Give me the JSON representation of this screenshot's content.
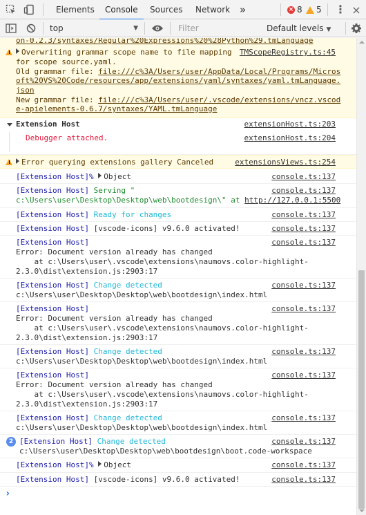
{
  "toolbar": {
    "tabs": [
      "Elements",
      "Console",
      "Sources",
      "Network"
    ],
    "more": "»",
    "errors": "8",
    "warnings": "5",
    "menu": "⋮"
  },
  "filterbar": {
    "context": "top",
    "filter_placeholder": "Filter",
    "levels": "Default levels"
  },
  "colors": {
    "accent": "#1a73e8",
    "warn_bg": "#fffbe5",
    "blue_text": "#1a1aa6",
    "cyan_text": "#22b7d8",
    "error_red": "#e0183c"
  },
  "messages": {
    "m0": {
      "line1": "on-0.2.3/syntaxes/Regular%20Expressions%20%28Python%29.tmLanguage"
    },
    "m1": {
      "l1": "Overwriting grammar scope name to file mapping",
      "src": "TMScopeRegistry.ts:45",
      "l2": "for scope source.yaml.",
      "l3a": "Old grammar file: ",
      "l3b": "file:///c%3A/Users/user/AppData/Local/Programs/Micros",
      "l4": "oft%20VS%20Code/resources/app/extensions/yaml/syntaxes/yaml.tmLanguage.",
      "l5": "json",
      "l6a": "New grammar file: ",
      "l6b": "file:///c%3A/Users/user/.vscode/extensions/vncz.vscod",
      "l7": "e-apielements-0.6.7/syntaxes/YAML.tmLanguage"
    },
    "m2": {
      "title": "Extension Host",
      "src": "extensionHost.ts:203",
      "child": "Debugger attached.",
      "child_src": "extensionHost.ts:204"
    },
    "m3": {
      "text": "Error querying extensions gallery Canceled",
      "src": "extensionsViews.ts:254"
    },
    "m4": {
      "prefix": "[Extension Host]%",
      "obj": "Object",
      "src": "console.ts:137"
    },
    "m5": {
      "prefix": "[Extension Host]",
      "text": "Serving \"",
      "l2a": "c:\\Users\\user\\Desktop\\Desktop\\web\\bootdesign\\\" at ",
      "l2b": "http://127.0.0.1:5500",
      "src": "console.ts:137"
    },
    "m6": {
      "prefix": "[Extension Host]",
      "text": "Ready for changes",
      "src": "console.ts:137"
    },
    "m7": {
      "prefix": "[Extension Host]",
      "text": "[vscode-icons] v9.6.0 activated!",
      "src": "console.ts:137"
    },
    "m8": {
      "prefix": "[Extension Host]",
      "l2": "Error: Document version already has changed",
      "l3": "    at c:\\Users\\user\\.vscode\\extensions\\naumovs.color-highlight-",
      "l4": "2.3.0\\dist\\extension.js:2903:17",
      "src": "console.ts:137"
    },
    "m9": {
      "prefix": "[Extension Host]",
      "text": "Change detected",
      "l2": "c:\\Users\\user\\Desktop\\Desktop\\web\\bootdesign\\index.html",
      "src": "console.ts:137"
    },
    "m10": {
      "prefix": "[Extension Host]",
      "l2": "Error: Document version already has changed",
      "l3": "    at c:\\Users\\user\\.vscode\\extensions\\naumovs.color-highlight-",
      "l4": "2.3.0\\dist\\extension.js:2903:17",
      "src": "console.ts:137"
    },
    "m11": {
      "prefix": "[Extension Host]",
      "text": "Change detected",
      "l2": "c:\\Users\\user\\Desktop\\Desktop\\web\\bootdesign\\index.html",
      "src": "console.ts:137"
    },
    "m12": {
      "prefix": "[Extension Host]",
      "l2": "Error: Document version already has changed",
      "l3": "    at c:\\Users\\user\\.vscode\\extensions\\naumovs.color-highlight-",
      "l4": "2.3.0\\dist\\extension.js:2903:17",
      "src": "console.ts:137"
    },
    "m13": {
      "prefix": "[Extension Host]",
      "text": "Change detected",
      "l2": "c:\\Users\\user\\Desktop\\Desktop\\web\\bootdesign\\index.html",
      "src": "console.ts:137"
    },
    "m14": {
      "count": "2",
      "prefix": "[Extension Host]",
      "text": "Change detected",
      "l2": "c:\\Users\\user\\Desktop\\Desktop\\web\\bootdesign\\boot.code-workspace",
      "src": "console.ts:137"
    },
    "m15": {
      "prefix": "[Extension Host]%",
      "obj": "Object",
      "src": "console.ts:137"
    },
    "m16": {
      "prefix": "[Extension Host]",
      "text": "[vscode-icons] v9.6.0 activated!",
      "src": "console.ts:137"
    }
  },
  "prompt": "›"
}
